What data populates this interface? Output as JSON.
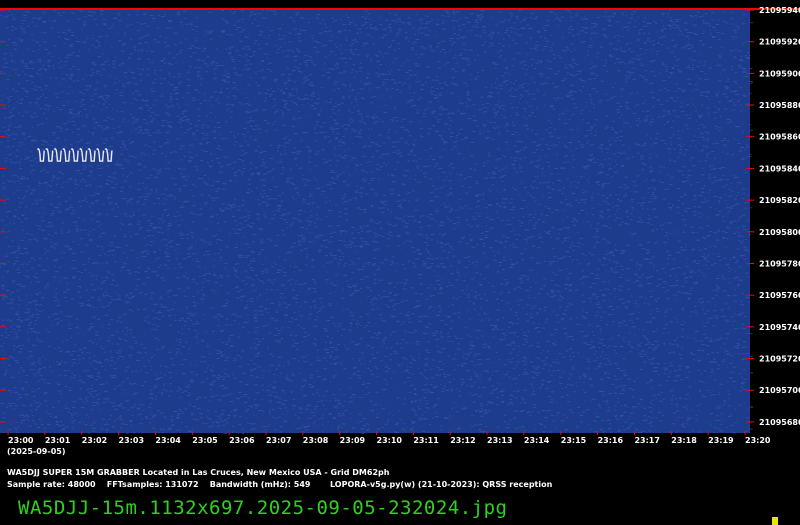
{
  "chart_data": {
    "type": "heatmap",
    "title": "",
    "ylabel": "",
    "xlabel": "",
    "date_label": "(2025-09-05)",
    "x_ticks": [
      "23:00",
      "23:01",
      "23:02",
      "23:03",
      "23:04",
      "23:05",
      "23:06",
      "23:07",
      "23:08",
      "23:09",
      "23:10",
      "23:11",
      "23:12",
      "23:13",
      "23:14",
      "23:15",
      "23:16",
      "23:17",
      "23:18",
      "23:19",
      "23:20"
    ],
    "y_ticks": [
      21095940,
      21095920,
      21095900,
      21095880,
      21095860,
      21095840,
      21095820,
      21095800,
      21095780,
      21095760,
      21095740,
      21095720,
      21095700,
      21095680
    ],
    "ylim": [
      21095673,
      21095940
    ],
    "xlim": [
      "23:00",
      "23:20"
    ],
    "signal": {
      "time_range": [
        "23:00:48",
        "23:02:52"
      ],
      "frequency_hz": [
        21095844,
        21095850
      ],
      "description": "QRSS"
    },
    "colors": {
      "background": "#1e3c8c",
      "noise": "#3a5cc0",
      "signal": "#ffffff",
      "top_line": "#ff0000",
      "tick_mark": "#ff0000",
      "axis_text": "#ffffff"
    }
  },
  "info": {
    "line1": "WA5DJJ SUPER 15M GRABBER Located in Las Cruces, New Mexico USA - Grid DM62ph",
    "line2": "Sample rate: 48000    FFTsamples: 131072    Bandwidth (mHz): 549       LOPORA-v5g.py(w) (21-10-2023): QRSS reception"
  },
  "filename": "WA5DJJ-15m.1132x697.2025-09-05-232024.jpg",
  "indicator_color": "#e6e600"
}
